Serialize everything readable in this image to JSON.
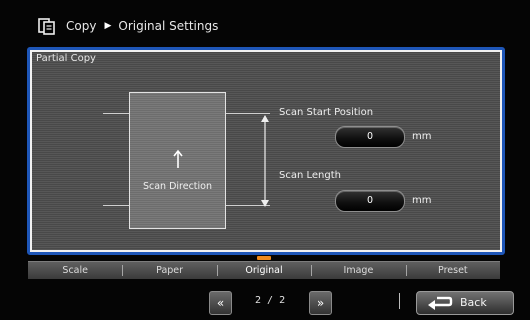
{
  "header": {
    "icon": "copy-icon",
    "section": "Copy",
    "page": "Original Settings"
  },
  "panel": {
    "title": "Partial Copy",
    "scan_direction_label": "Scan Direction",
    "scan_start_label": "Scan Start Position",
    "scan_start_value": "0",
    "scan_length_label": "Scan Length",
    "scan_length_value": "0",
    "unit": "mm"
  },
  "tabs": [
    {
      "label": "Scale",
      "active": false
    },
    {
      "label": "Paper",
      "active": false
    },
    {
      "label": "Original",
      "active": true
    },
    {
      "label": "Image",
      "active": false
    },
    {
      "label": "Preset",
      "active": false
    }
  ],
  "pager": {
    "prev_icon": "double-chevron-left-icon",
    "next_icon": "double-chevron-right-icon",
    "prev_glyph": "«",
    "next_glyph": "»",
    "text": "2 / 2",
    "current": 2,
    "total": 2
  },
  "back": {
    "label": "Back",
    "icon": "return-arrow-icon"
  },
  "colors": {
    "panel_border": "#1e56b8",
    "active_tab_indicator": "#f08a1c"
  }
}
